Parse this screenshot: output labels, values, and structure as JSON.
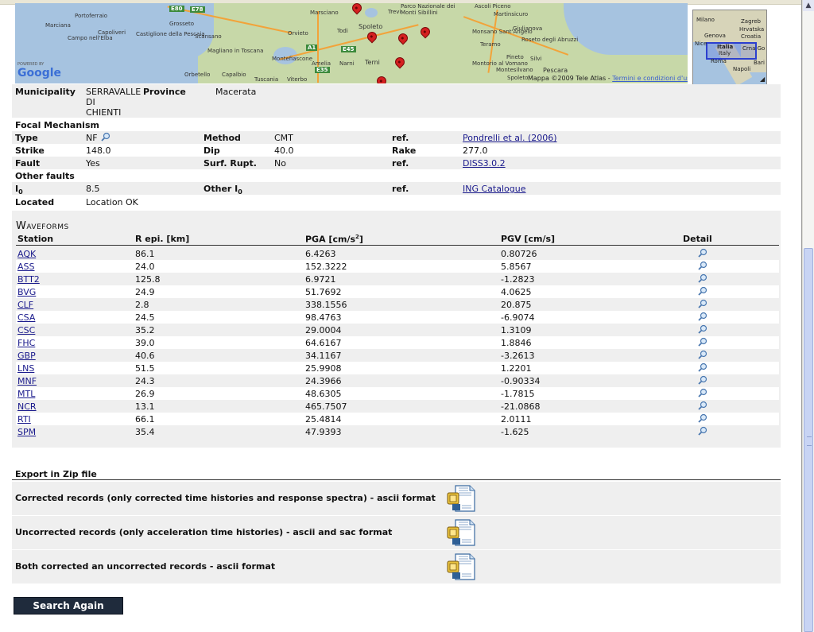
{
  "map": {
    "labels": [
      {
        "text": "Portoferraio"
      },
      {
        "text": "Marciana"
      },
      {
        "text": "Campo nell'Elba"
      },
      {
        "text": "Capoliveri"
      },
      {
        "text": "Castiglione della Pescaia"
      },
      {
        "text": "Grosseto"
      },
      {
        "text": "Scansano"
      },
      {
        "text": "Magliano in Toscana"
      },
      {
        "text": "Orbetello"
      },
      {
        "text": "Capalbio"
      },
      {
        "text": "Tuscania"
      },
      {
        "text": "Viterbo"
      },
      {
        "text": "Orvieto"
      },
      {
        "text": "Todi"
      },
      {
        "text": "Marsciano"
      },
      {
        "text": "Spoleto"
      },
      {
        "text": "Montefiascone"
      },
      {
        "text": "Amelia"
      },
      {
        "text": "Narni"
      },
      {
        "text": "Terni"
      },
      {
        "text": "Trevi"
      },
      {
        "text": "Parco Nazionale dei Monti Sibillini"
      },
      {
        "text": "Ascoli Piceno"
      },
      {
        "text": "Martinsicuro"
      },
      {
        "text": "Giulianova"
      },
      {
        "text": "Teramo"
      },
      {
        "text": "Monsano Sant'Angelo"
      },
      {
        "text": "Roseto degli Abruzzi"
      },
      {
        "text": "Montorio al Vomano"
      },
      {
        "text": "Pineto"
      },
      {
        "text": "Silvi"
      },
      {
        "text": "Montesilvano"
      },
      {
        "text": "Pescara"
      },
      {
        "text": "Spoleto"
      }
    ],
    "road_badges": [
      "E80",
      "E78",
      "A1",
      "E45",
      "E35"
    ],
    "brand": "Google",
    "powered": "POWERED BY",
    "credit": "Mappa ©2009 Tele Atlas - ",
    "credit_link": "Termini e condizioni d'uso",
    "minimap_labels": [
      "Milano",
      "Zagreb",
      "Hrvatska",
      "Genova",
      "Croatia",
      "Nice",
      "Italia",
      "Italy",
      "Crna Go",
      "Roma",
      "Bari",
      "Napoli"
    ]
  },
  "info": {
    "municipality_label": "Municipality",
    "municipality_value_lines": [
      "SERRAVALLE",
      "DI",
      "CHIENTI"
    ],
    "province_label": "Province",
    "province_value": "Macerata",
    "focal_label": "Focal Mechanism",
    "type_label": "Type",
    "type_value": "NF",
    "method_label": "Method",
    "method_value": "CMT",
    "ref1_label": "ref.",
    "ref1_value": "Pondrelli et al. (2006)",
    "strike_label": "Strike",
    "strike_value": "148.0",
    "dip_label": "Dip",
    "dip_value": "40.0",
    "rake_label": "Rake",
    "rake_value": "277.0",
    "fault_label": "Fault",
    "fault_value": "Yes",
    "surf_label": "Surf. Rupt.",
    "surf_value": "No",
    "ref2_label": "ref.",
    "ref2_value": "DISS3.0.2",
    "other_faults_label": "Other faults",
    "i0_label": "I",
    "i0_sub": "0",
    "i0_value": "8.5",
    "other_i0_label": "Other I",
    "other_i0_sub": "0",
    "ref3_label": "ref.",
    "ref3_value": "ING Catalogue",
    "located_label": "Located",
    "located_value": "Location OK"
  },
  "waveforms": {
    "title": "Waveforms",
    "headers": {
      "station": "Station",
      "repi": "R epi. [km]",
      "pga_pre": "PGA [cm/s",
      "pga_sup": "2",
      "pga_post": "]",
      "pgv": "PGV [cm/s]",
      "detail": "Detail"
    },
    "rows": [
      {
        "station": "AQK",
        "repi": "86.1",
        "pga": "6.4263",
        "pgv": "0.80726"
      },
      {
        "station": "ASS",
        "repi": "24.0",
        "pga": "152.3222",
        "pgv": "5.8567"
      },
      {
        "station": "BTT2",
        "repi": "125.8",
        "pga": "6.9721",
        "pgv": "-1.2823"
      },
      {
        "station": "BVG",
        "repi": "24.9",
        "pga": "51.7692",
        "pgv": "4.0625"
      },
      {
        "station": "CLF",
        "repi": "2.8",
        "pga": "338.1556",
        "pgv": "20.875"
      },
      {
        "station": "CSA",
        "repi": "24.5",
        "pga": "98.4763",
        "pgv": "-6.9074"
      },
      {
        "station": "CSC",
        "repi": "35.2",
        "pga": "29.0004",
        "pgv": "1.3109"
      },
      {
        "station": "FHC",
        "repi": "39.0",
        "pga": "64.6167",
        "pgv": "1.8846"
      },
      {
        "station": "GBP",
        "repi": "40.6",
        "pga": "34.1167",
        "pgv": "-3.2613"
      },
      {
        "station": "LNS",
        "repi": "51.5",
        "pga": "25.9908",
        "pgv": "1.2201"
      },
      {
        "station": "MNF",
        "repi": "24.3",
        "pga": "24.3966",
        "pgv": "-0.90334"
      },
      {
        "station": "MTL",
        "repi": "26.9",
        "pga": "48.6305",
        "pgv": "-1.7815"
      },
      {
        "station": "NCR",
        "repi": "13.1",
        "pga": "465.7507",
        "pgv": "-21.0868"
      },
      {
        "station": "RTI",
        "repi": "66.1",
        "pga": "25.4814",
        "pgv": "2.0111"
      },
      {
        "station": "SPM",
        "repi": "35.4",
        "pga": "47.9393",
        "pgv": "-1.625"
      }
    ]
  },
  "export": {
    "title": "Export in Zip file",
    "items": [
      {
        "label": "Corrected records (only corrected time histories and response spectra) - ascii format"
      },
      {
        "label": "Uncorrected records (only acceleration time histories) - ascii and sac format"
      },
      {
        "label": "Both corrected an uncorrected records - ascii format"
      }
    ]
  },
  "search_again": "Search Again",
  "colors": {
    "link": "#1a1a8c",
    "row_alt": "#eeeeee",
    "button": "#1f2b3c",
    "map_land": "#c7d8a8",
    "map_sea": "#a6c3e0",
    "pin": "#d42020"
  }
}
